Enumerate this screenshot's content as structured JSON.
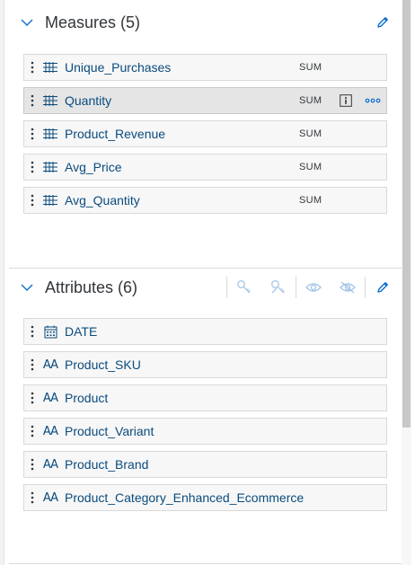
{
  "measures": {
    "title": "Measures (5)",
    "items": [
      {
        "name": "Unique_Purchases",
        "aggregation": "SUM"
      },
      {
        "name": "Quantity",
        "aggregation": "SUM"
      },
      {
        "name": "Product_Revenue",
        "aggregation": "SUM"
      },
      {
        "name": "Avg_Price",
        "aggregation": "SUM"
      },
      {
        "name": "Avg_Quantity",
        "aggregation": "SUM"
      }
    ]
  },
  "attributes": {
    "title": "Attributes (6)",
    "items": [
      {
        "name": "DATE",
        "icon": "calendar-icon"
      },
      {
        "name": "Product_SKU",
        "icon": "text-type-icon"
      },
      {
        "name": "Product",
        "icon": "text-type-icon"
      },
      {
        "name": "Product_Variant",
        "icon": "text-type-icon"
      },
      {
        "name": "Product_Brand",
        "icon": "text-type-icon"
      },
      {
        "name": "Product_Category_Enhanced_Ecommerce",
        "icon": "text-type-icon"
      }
    ]
  },
  "icons": {
    "collapse": "chevron-down-icon",
    "edit": "pencil-icon",
    "drag": "grip-vertical-icon",
    "measure": "measure-icon",
    "info": "info-icon",
    "more": "overflow-icon",
    "key": "key-icon",
    "unkey": "remove-key-icon",
    "show": "eye-icon",
    "hide": "eye-slash-icon",
    "text_type_glyph": "AA"
  },
  "colors": {
    "link": "#0a4b7d",
    "icon": "#0a6ed1",
    "row_bg": "#f7f7f7",
    "row_hover_bg": "#e5e5e5",
    "border": "#d9d9d9",
    "disabled_icon": "#a3c5e8"
  }
}
